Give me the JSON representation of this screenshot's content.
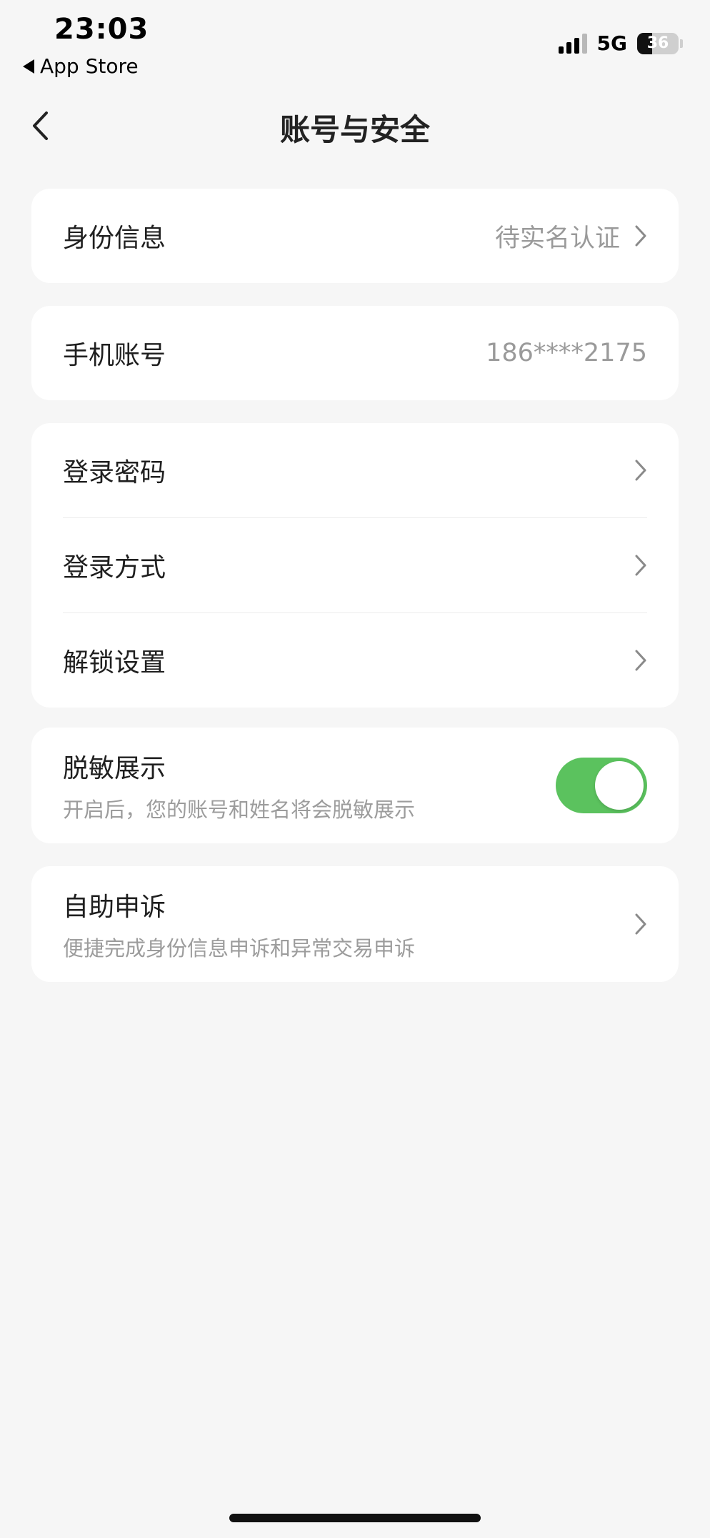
{
  "status_bar": {
    "time": "23:03",
    "back_app": "App Store",
    "network": "5G",
    "battery": "36",
    "battery_level": 0.36
  },
  "nav": {
    "title": "账号与安全"
  },
  "identity": {
    "label": "身份信息",
    "value": "待实名认证"
  },
  "phone": {
    "label": "手机账号",
    "value": "186****2175"
  },
  "security": {
    "items": [
      {
        "label": "登录密码"
      },
      {
        "label": "登录方式"
      },
      {
        "label": "解锁设置"
      }
    ]
  },
  "masking": {
    "label": "脱敏展示",
    "description": "开启后，您的账号和姓名将会脱敏展示",
    "enabled": true
  },
  "appeal": {
    "label": "自助申诉",
    "description": "便捷完成身份信息申诉和异常交易申诉"
  },
  "colors": {
    "toggle_on": "#5bc25e",
    "background": "#f6f6f6",
    "card": "#ffffff"
  }
}
